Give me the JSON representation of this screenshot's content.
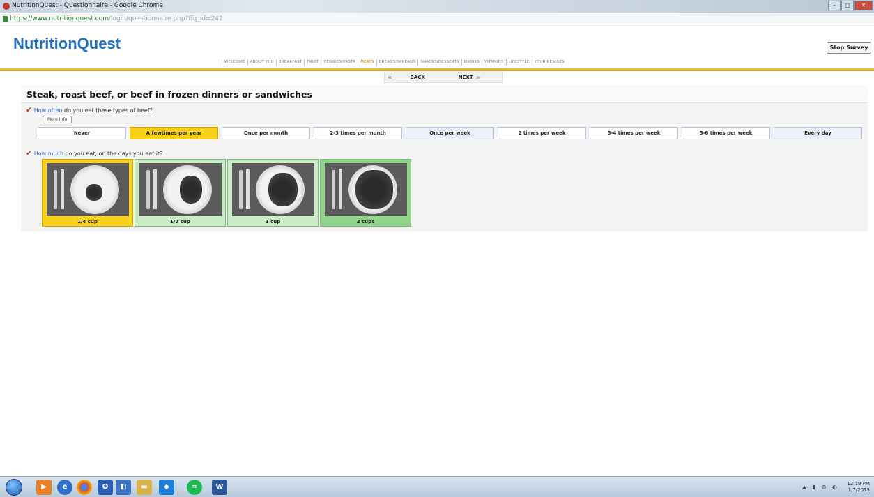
{
  "browser": {
    "window_title": "NutritionQuest - Questionnaire - Google Chrome",
    "url_host": "https://www.nutritionquest.com",
    "url_path": "/login/questionnaire.php?ffq_id=242"
  },
  "app": {
    "logo": "NutritionQuest",
    "stop_label": "Stop Survey",
    "nav": [
      "WELCOME",
      "ABOUT YOU",
      "BREAKFAST",
      "FRUIT",
      "VEGGIES/PASTA",
      "MEATS",
      "BREADS/SPREADS",
      "SNACKS/DESSERTS",
      "DRINKS",
      "VITAMINS",
      "LIFESTYLE",
      "YOUR RESULTS"
    ],
    "active_nav": "MEATS",
    "back_label": "BACK",
    "next_label": "NEXT"
  },
  "question": {
    "title": "Steak, roast beef, or beef in frozen dinners or sandwiches",
    "q1_emph": "How often",
    "q1_rest": " do you eat these types of beef?",
    "more_info": "More Info",
    "frequencies": [
      "Never",
      "A fewtimes per year",
      "Once per month",
      "2-3 times per month",
      "Once per week",
      "2 times per week",
      "3-4 times per week",
      "5-6 times per week",
      "Every day"
    ],
    "selected_frequency": "A fewtimes per year",
    "q2_emph": "How much",
    "q2_rest": " do you eat, on the days you eat it?",
    "portions": [
      "1/4 cup",
      "1/2 cup",
      "1 cup",
      "2 cups"
    ],
    "selected_portion": "1/4 cup"
  },
  "taskbar": {
    "time": "12:19 PM",
    "date": "1/7/2013"
  },
  "colors": {
    "brand_blue": "#1f6fbf",
    "selected_yellow": "#f7d018",
    "portion_green": "#c9ebc6"
  }
}
